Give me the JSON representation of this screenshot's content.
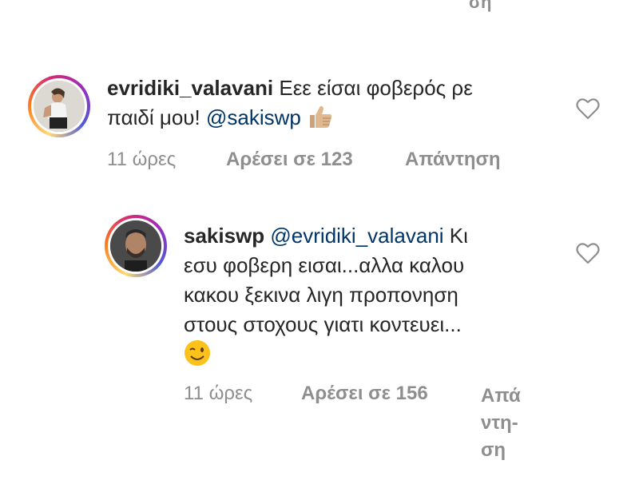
{
  "top_fragment": "ση",
  "comments": [
    {
      "username": "evridiki_valavani",
      "text": "Εεε είσαι φοβερός ρε",
      "text_line2": "παιδί μου!",
      "mention": "@sakiswp",
      "emoji": "thumbs-up",
      "time": "11 ώρες",
      "likes": "Αρέσει σε 123",
      "reply": "Απάντηση"
    },
    {
      "username": "sakiswp",
      "mention": "@evridiki_valavani",
      "text_tail": "Κι",
      "lines": [
        "εσυ φοβερη εισαι...αλλα καλου",
        "κακου ξεκινα λιγη προπονηση",
        "στους στοχους γιατι κοντευει..."
      ],
      "emoji": "winking-face",
      "time": "11 ώρες",
      "likes": "Αρέσει σε 156",
      "reply_lines": [
        "Απά",
        "ντη-",
        "ση"
      ]
    }
  ],
  "colors": {
    "text": "#262626",
    "meta": "#8e8e8e",
    "mention": "#003569"
  }
}
